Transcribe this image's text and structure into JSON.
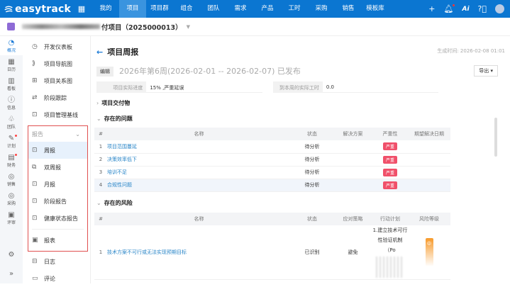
{
  "topbar": {
    "brand": "easytrack",
    "nav": [
      "我的",
      "项目",
      "项目群",
      "组合",
      "团队",
      "需求",
      "产品",
      "工时",
      "采购",
      "销售",
      "模板库"
    ],
    "active": "项目",
    "ai": "Ai"
  },
  "project": {
    "name_suffix": "付项目（2025000013）"
  },
  "rail": [
    "概况",
    "日历",
    "看板",
    "信息",
    "团队",
    "计划",
    "财务",
    "销售",
    "采购",
    "评审"
  ],
  "sidebar": {
    "top": [
      "开发仪表板",
      "项目导航图",
      "项目关系图",
      "阶段跟踪",
      "项目管理基线"
    ],
    "group_label": "报告",
    "reports": [
      "周报",
      "双周报",
      "月报",
      "阶段报告",
      "健康状态报告"
    ],
    "report_table": "报表",
    "bottom": [
      "日志",
      "评论"
    ]
  },
  "page": {
    "title": "项目周报",
    "generated": "生成时间: 2026-02-08 01:01",
    "edit": "编辑",
    "week": "2026年第6周(2026-02-01 -- 2026-02-07) 已发布",
    "export": "导出",
    "progress_label": "项目实际进度",
    "progress_value": "15% ,严重延误",
    "hours_label": "到本周的实际工时",
    "hours_value": "0.0",
    "deliverables": "项目交付物",
    "issues_title": "存在的问题",
    "risks_title": "存在的风险"
  },
  "issues": {
    "headers": [
      "#",
      "名称",
      "状态",
      "解决方案",
      "严重性",
      "期望解决日期"
    ],
    "rows": [
      {
        "n": "1",
        "name": "项目范围蔓延",
        "status": "待分析",
        "sev": "严重"
      },
      {
        "n": "2",
        "name": "决策效率低下",
        "status": "待分析",
        "sev": "严重"
      },
      {
        "n": "3",
        "name": "培训不足",
        "status": "待分析",
        "sev": "严重"
      },
      {
        "n": "4",
        "name": "合规性问题",
        "status": "待分析",
        "sev": "严重"
      }
    ]
  },
  "risks": {
    "headers": [
      "#",
      "名称",
      "状态",
      "应对策略",
      "行动计划",
      "风险等级"
    ],
    "rows": [
      {
        "n": "1",
        "name": "技术方案不可行或无法实现预期目标",
        "status": "已识别",
        "strategy": "避免",
        "plan1": "1.建立技术可行",
        "plan2": "性验证机制（Po",
        "level": "中"
      }
    ]
  },
  "colors": {
    "brand": "#0b76d1",
    "danger": "#f0506a",
    "medium": "#f79a2a"
  }
}
